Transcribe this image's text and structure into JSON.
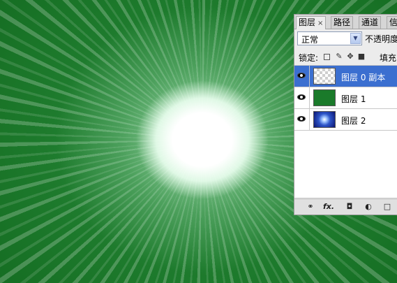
{
  "panel": {
    "tabs": [
      {
        "label": "图层",
        "close": "×"
      },
      {
        "label": "路径"
      },
      {
        "label": "通道"
      },
      {
        "label": "信"
      }
    ],
    "blend_mode": "正常",
    "opacity_label": "不透明度",
    "lock_label": "锁定:",
    "fill_label": "填充",
    "layers": [
      {
        "name": "图层 0 副本",
        "thumb": "transparent",
        "selected": true
      },
      {
        "name": "图层 1",
        "thumb": "green-fill"
      },
      {
        "name": "图层 2",
        "thumb": "blue-starburst"
      }
    ],
    "footer_icons": [
      "link-layers-icon",
      "fx-icon",
      "layer-mask-icon",
      "adjustment-layer-icon",
      "new-group-icon"
    ],
    "fx_label": "fx."
  },
  "colors": {
    "canvas_green": "#1d7a2c",
    "selection_blue": "#3b6fd0"
  }
}
